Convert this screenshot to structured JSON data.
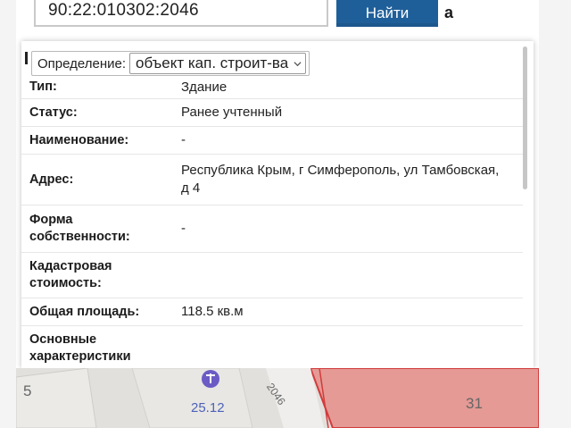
{
  "search": {
    "query": "90:22:010302:2046",
    "button_label": "Найти",
    "suffix": "а"
  },
  "card": {
    "definition_label": "Определение:",
    "definition_value": "объект кап. строит-ва",
    "rows": [
      {
        "label": "Тип:",
        "value": "Здание"
      },
      {
        "label": "Статус:",
        "value": "Ранее учтенный"
      },
      {
        "label": "Наименование:",
        "value": "-"
      },
      {
        "label": "Адрес:",
        "value": "Республика Крым, г Симферополь, ул Тамбовская, д 4"
      },
      {
        "label": "Форма собственности:",
        "value": "-"
      },
      {
        "label": "Кадастровая стоимость:",
        "value": ""
      },
      {
        "label": "Общая площадь:",
        "value": "118.5 кв.м"
      },
      {
        "label": "Основные характеристики",
        "value": ""
      }
    ]
  },
  "map": {
    "labels": {
      "left_number": "5",
      "date": "25.12",
      "right_number": "31",
      "street_code": "2046"
    },
    "colors": {
      "highlight": "#e59a95",
      "highlight_stroke": "#d13c3c",
      "ground": "#e2e0dd",
      "icon": "#6a5cc4"
    }
  },
  "colors": {
    "button": "#1f5f99",
    "text": "#1a1a1a"
  }
}
